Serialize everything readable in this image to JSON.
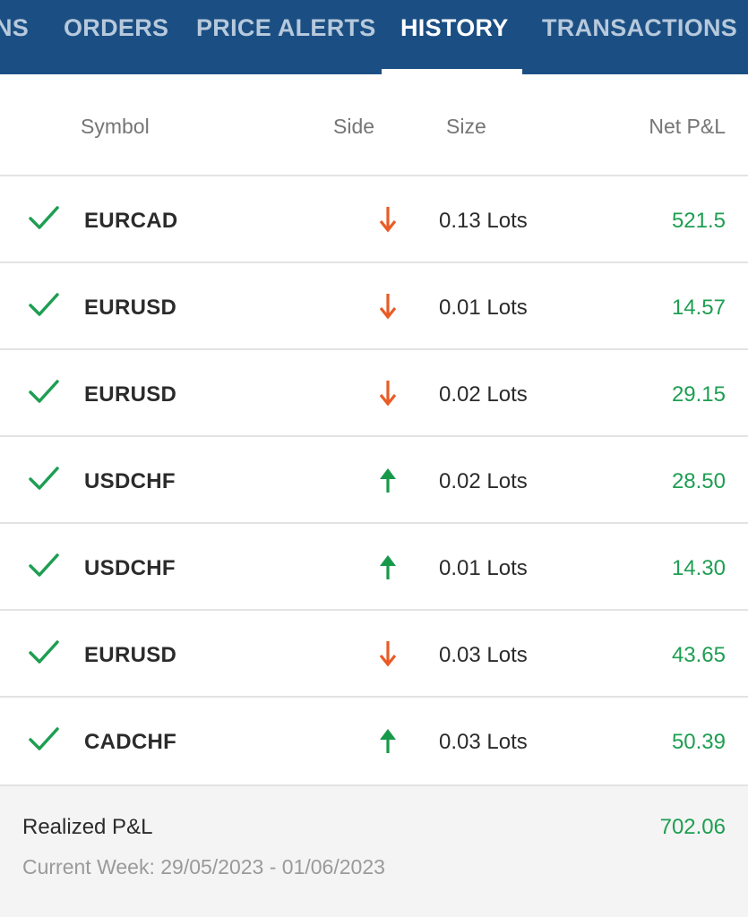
{
  "tabs": [
    {
      "label": "NS",
      "active": false
    },
    {
      "label": "ORDERS",
      "active": false
    },
    {
      "label": "PRICE ALERTS",
      "active": false
    },
    {
      "label": "HISTORY",
      "active": true
    },
    {
      "label": "TRANSACTIONS",
      "active": false
    }
  ],
  "columns": {
    "symbol": "Symbol",
    "side": "Side",
    "size": "Size",
    "net_pnl": "Net P&L"
  },
  "rows": [
    {
      "status_icon": "check-icon",
      "symbol": "EURCAD",
      "side": "sell",
      "side_icon": "arrow-down-icon",
      "size": "0.13 Lots",
      "net_pnl": "521.5"
    },
    {
      "status_icon": "check-icon",
      "symbol": "EURUSD",
      "side": "sell",
      "side_icon": "arrow-down-icon",
      "size": "0.01 Lots",
      "net_pnl": "14.57"
    },
    {
      "status_icon": "check-icon",
      "symbol": "EURUSD",
      "side": "sell",
      "side_icon": "arrow-down-icon",
      "size": "0.02 Lots",
      "net_pnl": "29.15"
    },
    {
      "status_icon": "check-icon",
      "symbol": "USDCHF",
      "side": "buy",
      "side_icon": "arrow-up-icon",
      "size": "0.02 Lots",
      "net_pnl": "28.50"
    },
    {
      "status_icon": "check-icon",
      "symbol": "USDCHF",
      "side": "buy",
      "side_icon": "arrow-up-icon",
      "size": "0.01 Lots",
      "net_pnl": "14.30"
    },
    {
      "status_icon": "check-icon",
      "symbol": "EURUSD",
      "side": "sell",
      "side_icon": "arrow-down-icon",
      "size": "0.03 Lots",
      "net_pnl": "43.65"
    },
    {
      "status_icon": "check-icon",
      "symbol": "CADCHF",
      "side": "buy",
      "side_icon": "arrow-up-icon",
      "size": "0.03 Lots",
      "net_pnl": "50.39"
    }
  ],
  "summary": {
    "label": "Realized P&L",
    "total": "702.06",
    "period": "Current Week: 29/05/2023 - 01/06/2023"
  },
  "colors": {
    "header_bg": "#1b4f83",
    "profit_green": "#1e9e52",
    "buy_arrow": "#17994a",
    "sell_arrow": "#ea5b25",
    "check": "#1e9e52"
  }
}
